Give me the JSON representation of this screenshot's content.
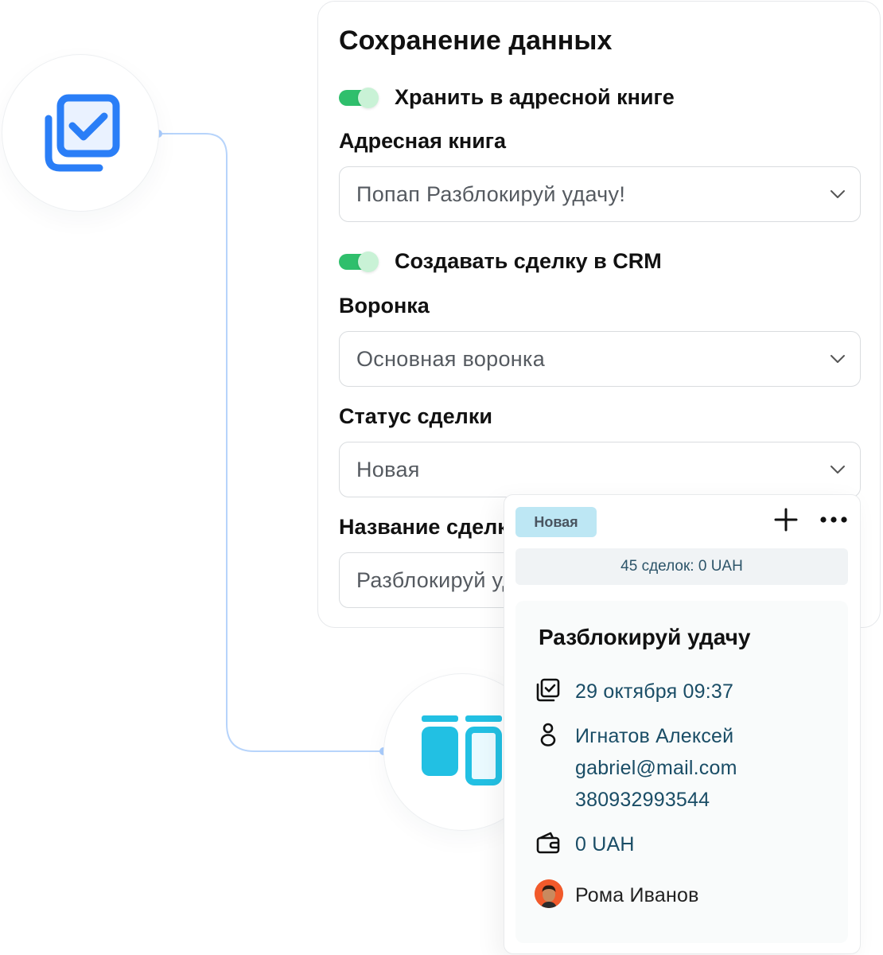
{
  "panel": {
    "title": "Сохранение данных",
    "save_contact_toggle": {
      "label": "Хранить в адресной книге",
      "on": true
    },
    "address_book": {
      "label": "Адресная книга",
      "value": "Попап Разблокируй удачу!"
    },
    "crm_toggle": {
      "label": "Создавать сделку в CRM",
      "on": true
    },
    "pipeline": {
      "label": "Воронка",
      "value": "Основная воронка"
    },
    "deal_status": {
      "label": "Статус сделки",
      "value": "Новая"
    },
    "deal_name": {
      "label": "Название сделки",
      "value": "Разблокируй удачу"
    }
  },
  "deal_card": {
    "status_badge": "Новая",
    "summary": "45 сделок: 0 UAH",
    "deal": {
      "name": "Разблокируй удачу",
      "date": "29 октября 09:37",
      "contact_name": "Игнатов Алексей",
      "contact_email": "gabriel@mail.com",
      "contact_phone": "380932993544",
      "amount": "0 UAH",
      "manager": "Рома Иванов"
    }
  },
  "colors": {
    "accent_blue": "#2a7ef7",
    "accent_cyan": "#22c0e3",
    "toggle_green": "#2fbf6c",
    "badge_bg": "#bde7f4",
    "link_text": "#1a4d66"
  },
  "icons": [
    "copy-check-icon",
    "kanban-board-icon",
    "plus-icon",
    "more-dots-icon",
    "calendar-check-icon",
    "person-icon",
    "wallet-icon",
    "chevron-down-icon"
  ]
}
